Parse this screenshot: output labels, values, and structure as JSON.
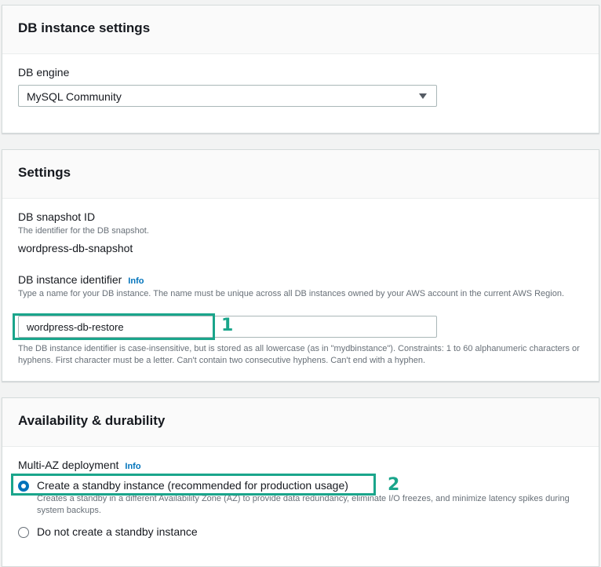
{
  "db_instance_settings": {
    "title": "DB instance settings",
    "engine_label": "DB engine",
    "engine_value": "MySQL Community"
  },
  "settings": {
    "title": "Settings",
    "snapshot_label": "DB snapshot ID",
    "snapshot_desc": "The identifier for the DB snapshot.",
    "snapshot_value": "wordpress-db-snapshot",
    "identifier_label": "DB instance identifier",
    "info_label": "Info",
    "identifier_desc": "Type a name for your DB instance. The name must be unique across all DB instances owned by your AWS account in the current AWS Region.",
    "identifier_value": "wordpress-db-restore",
    "identifier_help": "The DB instance identifier is case-insensitive, but is stored as all lowercase (as in \"mydbinstance\"). Constraints: 1 to 60 alphanumeric characters or hyphens. First character must be a letter. Can't contain two consecutive hyphens. Can't end with a hyphen."
  },
  "availability": {
    "title": "Availability & durability",
    "multi_az_label": "Multi-AZ deployment",
    "info_label": "Info",
    "options": [
      {
        "label": "Create a standby instance (recommended for production usage)",
        "desc": "Creates a standby in a different Availability Zone (AZ) to provide data redundancy, eliminate I/O freezes, and minimize latency spikes during system backups.",
        "selected": true
      },
      {
        "label": "Do not create a standby instance",
        "selected": false
      }
    ]
  },
  "annotations": {
    "callout_1": "1",
    "callout_2": "2"
  },
  "colors": {
    "accent": "#0073bb",
    "highlight": "#1aa58b"
  }
}
